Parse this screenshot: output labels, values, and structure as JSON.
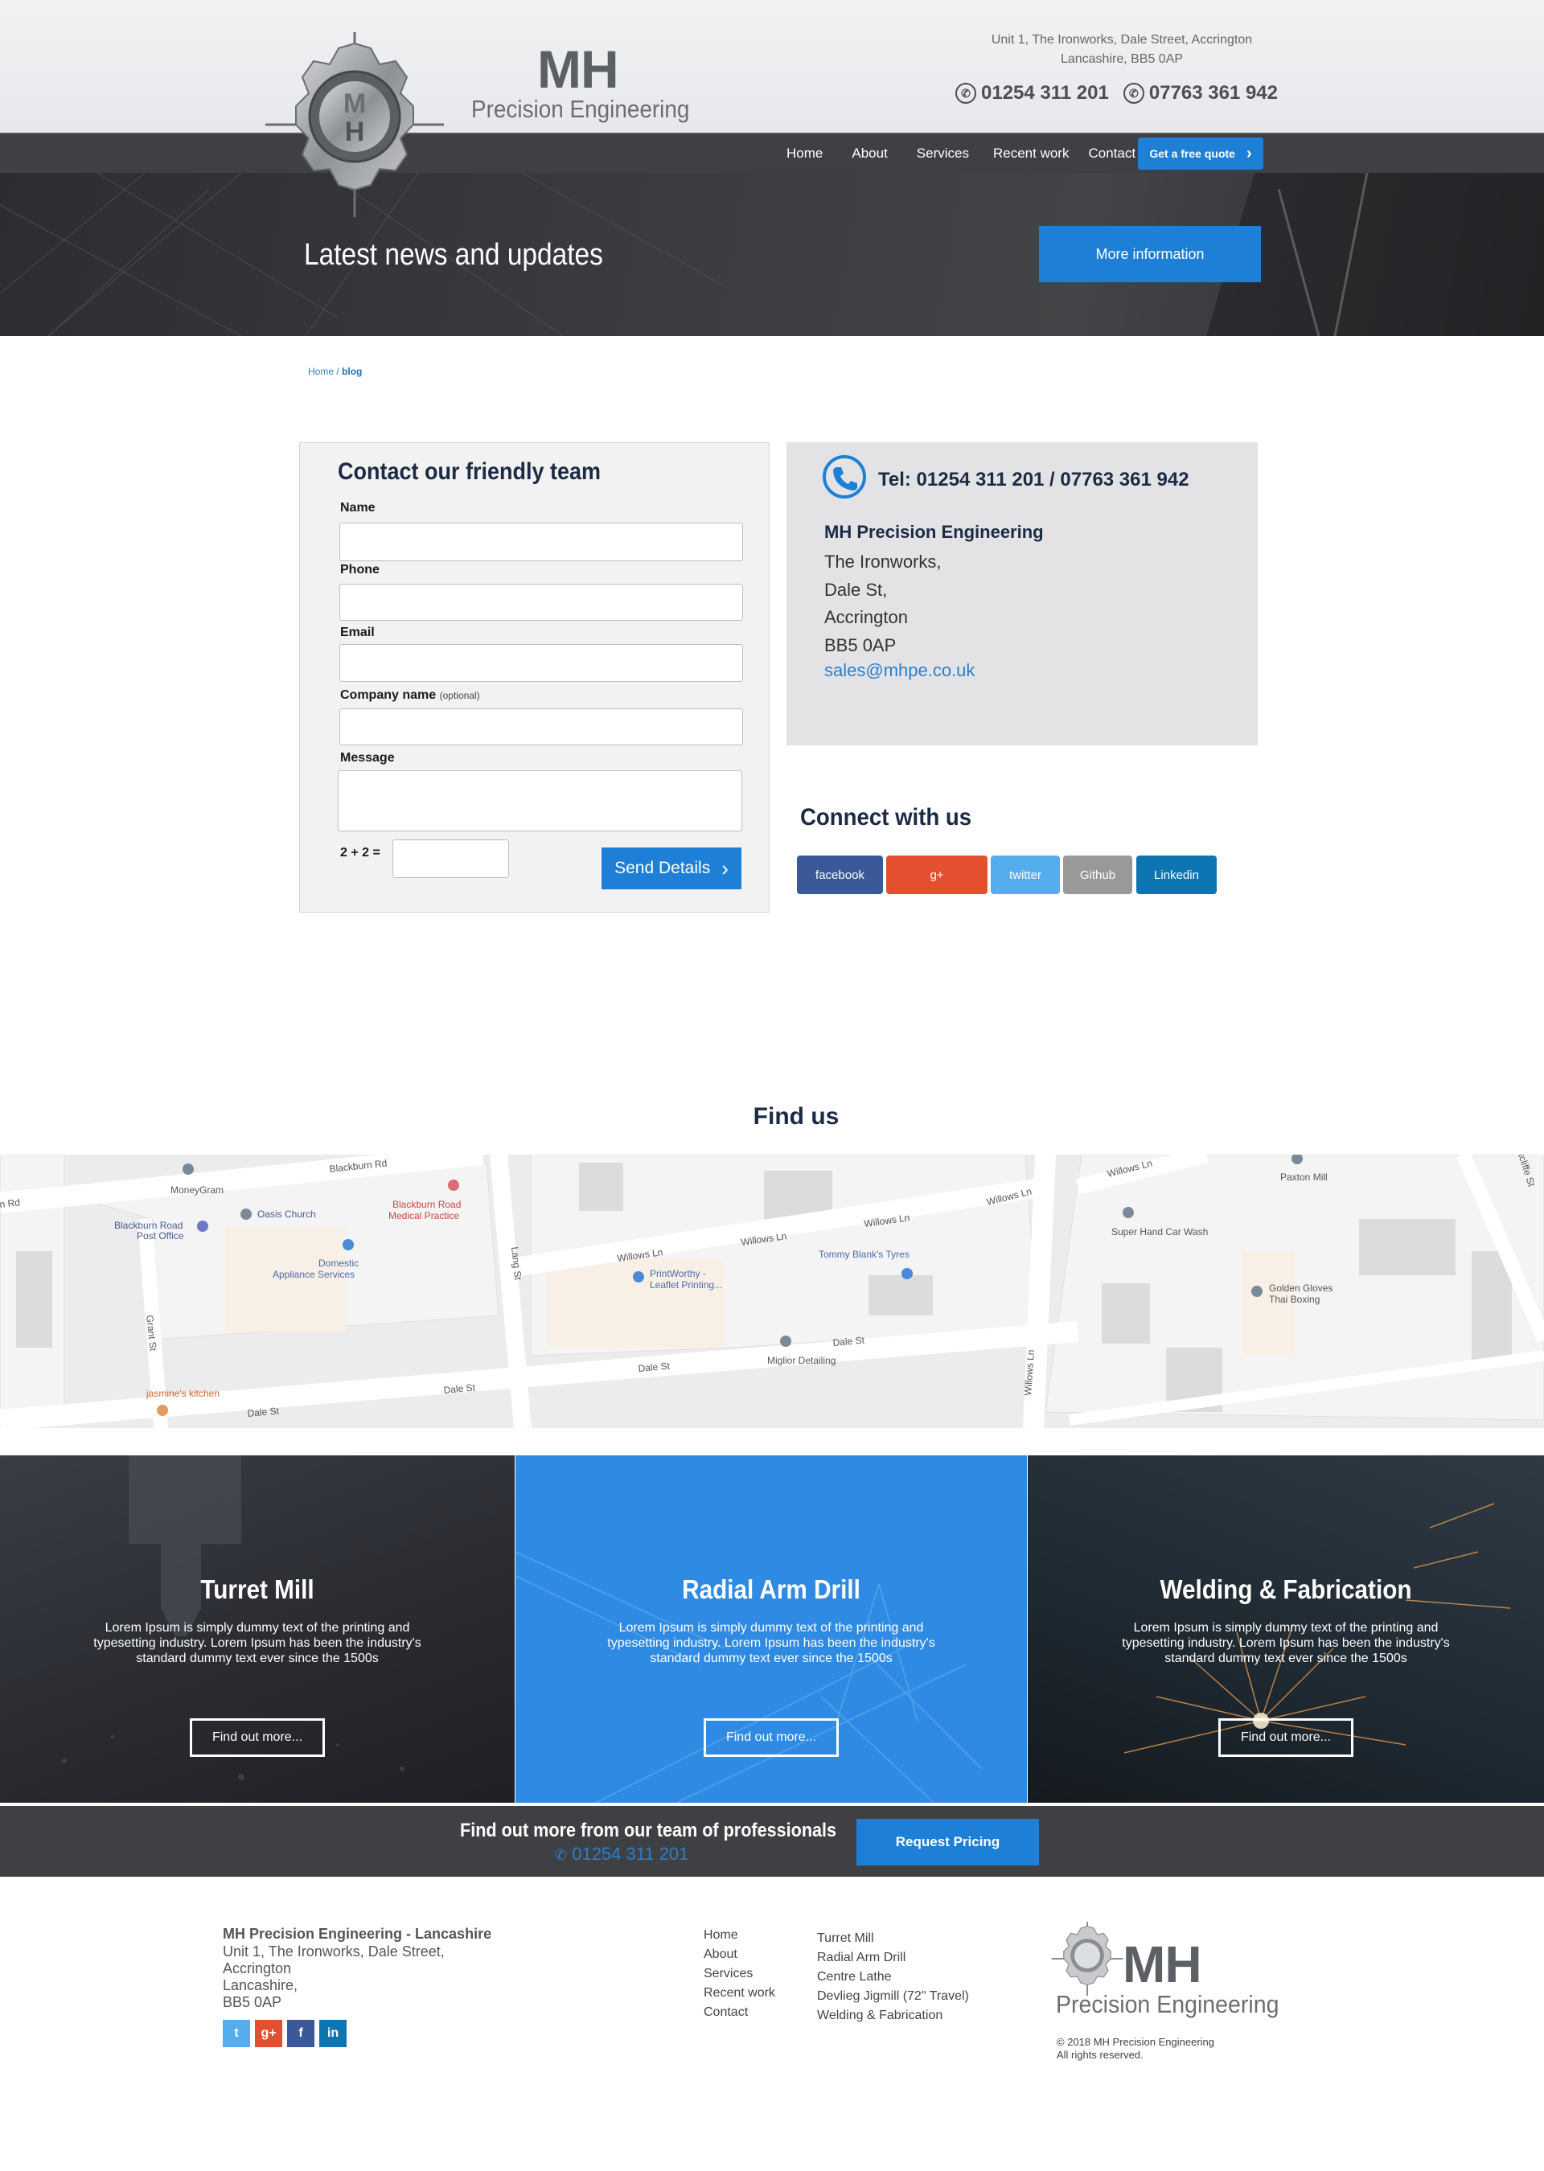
{
  "header": {
    "logo_mh": "MH",
    "logo_sub": "Precision Engineering",
    "logo_badge_letters": "MH",
    "address_line1": "Unit 1, The Ironworks, Dale Street, Accrington",
    "address_line2": "Lancashire, BB5 0AP",
    "phone1": "01254 311 201",
    "phone2": "07763 361 942"
  },
  "nav": {
    "items": [
      "Home",
      "About",
      "Services",
      "Recent work",
      "Contact"
    ],
    "quote_label": "Get a free quote"
  },
  "hero": {
    "title": "Latest news and updates",
    "button_label": "More information"
  },
  "breadcrumb": {
    "home": "Home",
    "separator": " / ",
    "current": "blog"
  },
  "form": {
    "title": "Contact our friendly team",
    "fields": [
      {
        "label": "Name",
        "optional": "",
        "value": ""
      },
      {
        "label": "Phone",
        "optional": "",
        "value": ""
      },
      {
        "label": "Email",
        "optional": "",
        "value": ""
      },
      {
        "label": "Company name",
        "optional": "(optional)",
        "value": ""
      },
      {
        "label": "Message",
        "optional": "",
        "value": ""
      }
    ],
    "captcha_label": "2 + 2 =",
    "send_label": "Send Details"
  },
  "contact_info": {
    "tel_line": "Tel: 01254 311 201 / 07763 361 942",
    "company": "MH Precision Engineering",
    "address": [
      "The Ironworks,",
      "Dale St,",
      "Accrington",
      "BB5 0AP"
    ],
    "email": "sales@mhpe.co.uk"
  },
  "connect": {
    "title": "Connect with us",
    "buttons": [
      {
        "label": "facebook",
        "color": "#3b5998"
      },
      {
        "label": "g+",
        "color": "#e4502f"
      },
      {
        "label": "twitter",
        "color": "#55aded"
      },
      {
        "label": "Github",
        "color": "#999999"
      },
      {
        "label": "Linkedin",
        "color": "#0e75b3"
      }
    ]
  },
  "find_us": {
    "title": "Find us",
    "map_labels": {
      "blackburn_rd_top": "Blackburn Rd",
      "rd_left": "n Rd",
      "moneygram": "MoneyGram",
      "oasis_church": "Oasis Church",
      "blackburn_road_po_1": "Blackburn Road",
      "blackburn_road_po_2": "Post Office",
      "medical_1": "Blackburn Road",
      "medical_2": "Medical Practice",
      "domestic_1": "Domestic",
      "domestic_2": "Appliance Services",
      "lang_st": "Lang St",
      "grant_st": "Grant St",
      "jasmines": "jasmine's kitchen",
      "dale_st_1": "Dale St",
      "dale_st_2": "Dale St",
      "dale_st_3": "Dale St",
      "dale_st_4": "Dale St",
      "willows_ln_1": "Willows Ln",
      "willows_ln_2": "Willows Ln",
      "willows_ln_3": "Willows Ln",
      "willows_ln_4": "Willows Ln",
      "willows_ln_5": "Willows Ln",
      "willows_ln_v": "Willows Ln",
      "printworthy_1": "PrintWorthy -",
      "printworthy_2": "Leaflet Printing...",
      "tommy_blanks": "Tommy Blank's Tyres",
      "miglior": "Miglior Detailing",
      "paxton_mill": "Paxton Mill",
      "super_hand": "Super Hand Car Wash",
      "golden_gloves_1": "Golden Gloves",
      "golden_gloves_2": "Thai Boxing",
      "cliffe_st": "tcliffe St"
    }
  },
  "services": [
    {
      "title": "Turret Mill",
      "text": "Lorem Ipsum is simply dummy text of the printing and typesetting industry. Lorem Ipsum has been the industry's standard dummy text ever since the 1500s",
      "button": "Find out more..."
    },
    {
      "title": "Radial Arm Drill",
      "text": "Lorem Ipsum is simply dummy text of the printing and typesetting industry. Lorem Ipsum has been the industry's standard dummy text ever since the 1500s",
      "button": "Find out more..."
    },
    {
      "title": "Welding & Fabrication",
      "text": "Lorem Ipsum is simply dummy text of the printing and typesetting industry. Lorem Ipsum has been the industry's standard dummy text ever since the 1500s",
      "button": "Find out more..."
    }
  ],
  "cta": {
    "title": "Find out more from our team of professionals",
    "phone": "01254 311 201",
    "button": "Request Pricing"
  },
  "footer": {
    "company": "MH Precision Engineering - Lancashire",
    "address": [
      "Unit 1, The Ironworks, Dale Street,",
      "Accrington",
      "Lancashire,",
      "BB5 0AP"
    ],
    "social": [
      {
        "label": "t",
        "icon": "twitter-icon",
        "color": "#55aded"
      },
      {
        "label": "g+",
        "icon": "google-plus-icon",
        "color": "#e4502f"
      },
      {
        "label": "f",
        "icon": "facebook-icon",
        "color": "#3b5998"
      },
      {
        "label": "in",
        "icon": "linkedin-icon",
        "color": "#0e75b3"
      }
    ],
    "nav": [
      "Home",
      "About",
      "Services",
      "Recent work",
      "Contact"
    ],
    "services": [
      "Turret Mill",
      "Radial Arm Drill",
      "Centre Lathe",
      "Devlieg Jigmill (72\" Travel)",
      "Welding & Fabrication"
    ],
    "logo_mh": "MH",
    "logo_sub": "Precision Engineering",
    "copyright": "© 2018 MH Precision Engineering",
    "rights": "All rights reserved."
  },
  "colors": {
    "accent": "#1e7fd6",
    "nav_bg": "#3f4043",
    "heading": "#1c2a45"
  }
}
